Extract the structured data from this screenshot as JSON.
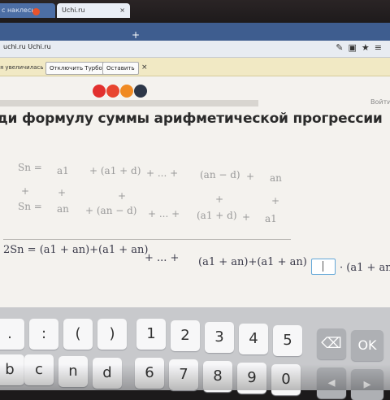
{
  "browser": {
    "tabs": [
      {
        "label": "с наклесь"
      },
      {
        "label": "Uchi.ru",
        "close": "×"
      }
    ],
    "new_tab": "+",
    "address": "uchi.ru  Uchi.ru",
    "icons": [
      "refresh-icon",
      "reader-icon",
      "star-icon",
      "menu-icon"
    ]
  },
  "notification": {
    "text": "я увеличилась",
    "buttons": [
      "Отключить Турбо",
      "Оставить"
    ],
    "close": "×"
  },
  "page": {
    "progress_dots": [
      {
        "color": "#e2302e"
      },
      {
        "color": "#e8452f"
      },
      {
        "color": "#f08a22"
      },
      {
        "color": "#2d3748"
      }
    ],
    "login_link": "Войти",
    "heading": "ди формулу суммы арифметической прогрессии",
    "row1": {
      "lhs": "Sn =",
      "t1": "a1",
      "t2": "+ (a1 + d)",
      "t3": "+ ... +",
      "t4": "(an − d)",
      "t5": "+",
      "t6": "an"
    },
    "plus_row": "+",
    "row2": {
      "lhs": "Sn =",
      "t1": "an",
      "t2": "+ (an − d)",
      "t3": "+ ... +",
      "t4": "(a1 + d)",
      "t5": "+",
      "t6": "a1"
    },
    "row3": {
      "lhs": "2Sn = (a1 + an)+(a1 + an)",
      "t3": "+ ... +",
      "t4": "(a1 + an)+(a1 + an) =",
      "t6": "· (a1 + an"
    }
  },
  "keyboard": {
    "row1": [
      ".",
      ":",
      "(",
      ")",
      "1",
      "2",
      "3",
      "4",
      "5",
      "⌫",
      "OK"
    ],
    "row2": [
      "b",
      "c",
      "n",
      "d",
      "6",
      "7",
      "8",
      "9",
      "0",
      "◂",
      "▸"
    ]
  }
}
